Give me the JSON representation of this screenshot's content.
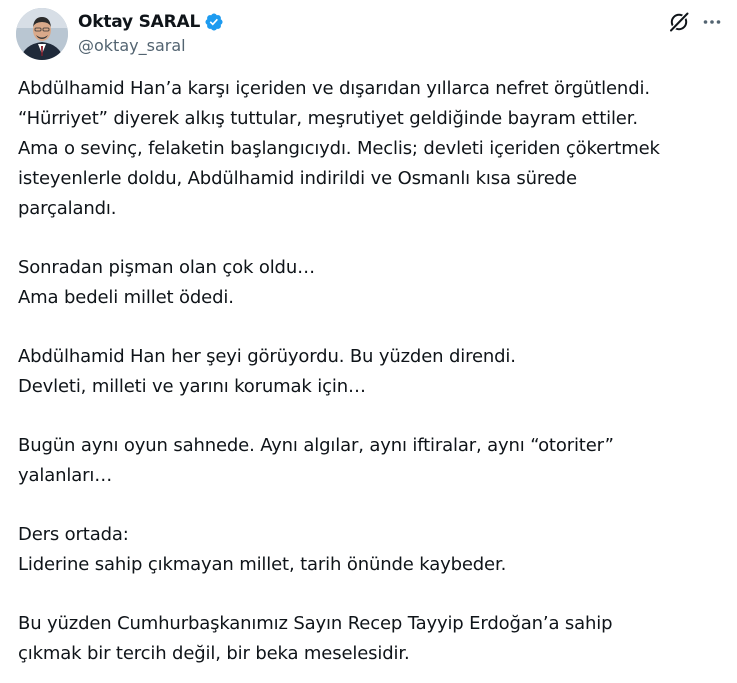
{
  "author": {
    "display_name": "Oktay SARAL",
    "handle": "@oktay_saral",
    "verified": true
  },
  "icons": {
    "verified": "verified-badge-icon",
    "grok": "grok-icon",
    "more": "more-options-icon"
  },
  "colors": {
    "verified_blue": "#1d9bf0",
    "text_primary": "#0f1419",
    "text_secondary": "#536471"
  },
  "tweet": {
    "paragraphs": [
      [
        "Abdülhamid Han’a karşı içeriden ve dışarıdan yıllarca nefret örgütlendi.",
        "“Hürriyet” diyerek alkış tuttular, meşrutiyet geldiğinde bayram ettiler.",
        "Ama o sevinç, felaketin başlangıcıydı. Meclis; devleti içeriden çökertmek",
        "isteyenlerle doldu, Abdülhamid indirildi ve Osmanlı kısa sürede",
        "parçalandı."
      ],
      [
        "Sonradan pişman olan çok oldu…",
        "Ama bedeli millet ödedi."
      ],
      [
        "Abdülhamid Han her şeyi görüyordu. Bu yüzden direndi.",
        "Devleti, milleti ve yarını korumak için…"
      ],
      [
        "Bugün aynı oyun sahnede. Aynı algılar, aynı iftiralar, aynı “otoriter”",
        "yalanları…"
      ],
      [
        "Ders ortada:",
        "Liderine sahip çıkmayan millet, tarih önünde kaybeder."
      ],
      [
        "Bu yüzden Cumhurbaşkanımız Sayın Recep Tayyip Erdoğan’a sahip",
        "çıkmak bir tercih değil, bir beka meselesidir."
      ]
    ]
  }
}
